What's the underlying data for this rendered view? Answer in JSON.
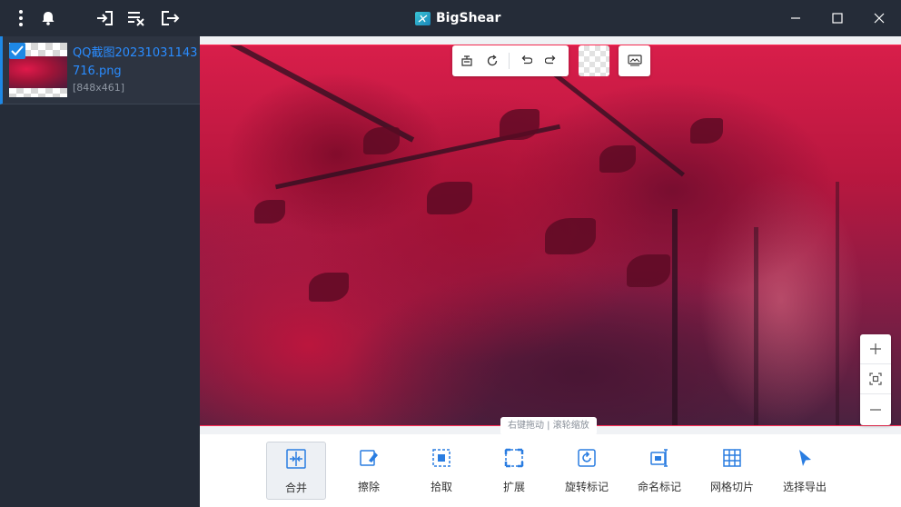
{
  "app": {
    "title": "BigShear"
  },
  "titlebar": {
    "icons": [
      "more-vertical-icon",
      "bell-icon",
      "import-icon",
      "clear-list-icon",
      "exit-icon"
    ],
    "window_controls": [
      "minimize-icon",
      "maximize-icon",
      "close-icon"
    ]
  },
  "sidebar": {
    "files": [
      {
        "name": "QQ截图20231031143716.png",
        "dimensions": "[848x461]",
        "checked": true
      }
    ]
  },
  "canvas": {
    "top_toolbar_icons": [
      "fit-icon",
      "rotate-icon",
      "undo-icon",
      "redo-icon",
      "transparent-bg-icon",
      "preview-icon"
    ],
    "zoom_controls": [
      "zoom-in-icon",
      "fit-screen-icon",
      "zoom-out-icon"
    ],
    "hint": "右键拖动 | 滚轮缩放"
  },
  "toolbar": {
    "tools": [
      {
        "label": "合并",
        "icon": "merge-icon",
        "active": true
      },
      {
        "label": "擦除",
        "icon": "eraser-icon",
        "active": false
      },
      {
        "label": "拾取",
        "icon": "pick-icon",
        "active": false
      },
      {
        "label": "扩展",
        "icon": "expand-icon",
        "active": false
      },
      {
        "label": "旋转标记",
        "icon": "rotate-mark-icon",
        "active": false
      },
      {
        "label": "命名标记",
        "icon": "name-mark-icon",
        "active": false
      },
      {
        "label": "网格切片",
        "icon": "grid-slice-icon",
        "active": false
      },
      {
        "label": "选择导出",
        "icon": "select-export-icon",
        "active": false
      }
    ]
  },
  "colors": {
    "accent": "#1e88e5",
    "titlebar": "#252c38",
    "border_highlight": "#ff2d55",
    "tool_icon": "#2a7de1"
  }
}
